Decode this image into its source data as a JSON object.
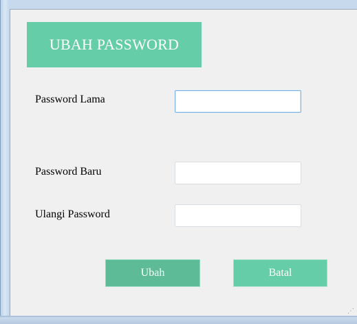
{
  "header": {
    "title": "UBAH PASSWORD"
  },
  "form": {
    "old_password_label": "Password Lama",
    "old_password_value": "",
    "new_password_label": "Password Baru",
    "new_password_value": "",
    "repeat_password_label": "Ulangi Password",
    "repeat_password_value": ""
  },
  "actions": {
    "submit_label": "Ubah",
    "cancel_label": "Batal"
  },
  "colors": {
    "accent": "#66cda9",
    "accent_dark": "#5dbb97",
    "background": "#f0f0f0"
  }
}
